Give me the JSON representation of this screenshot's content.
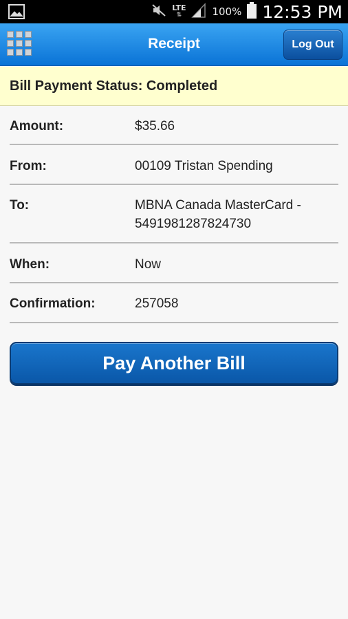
{
  "status_bar": {
    "network": "LTE",
    "battery_percent": "100%",
    "time": "12:53 PM",
    "icons": [
      "gallery-icon",
      "mute-icon",
      "signal-icon",
      "battery-icon"
    ]
  },
  "header": {
    "title": "Receipt",
    "logout_label": "Log Out",
    "menu_icon": "grid-menu-icon",
    "colors": {
      "bar_top": "#3aa4f2",
      "bar_bottom": "#0a73d6"
    }
  },
  "banner": {
    "text": "Bill Payment Status: Completed",
    "background": "#ffffcf"
  },
  "details": [
    {
      "label": "Amount:",
      "value": "$35.66"
    },
    {
      "label": "From:",
      "value": "00109 Tristan Spending"
    },
    {
      "label": "To:",
      "value_line1": "MBNA Canada MasterCard -",
      "value_line2": "5491981287824730"
    },
    {
      "label": "When:",
      "value": "Now"
    },
    {
      "label": "Confirmation:",
      "value": "257058"
    }
  ],
  "actions": {
    "pay_another_label": "Pay Another Bill",
    "accent": "#0a57a8"
  }
}
